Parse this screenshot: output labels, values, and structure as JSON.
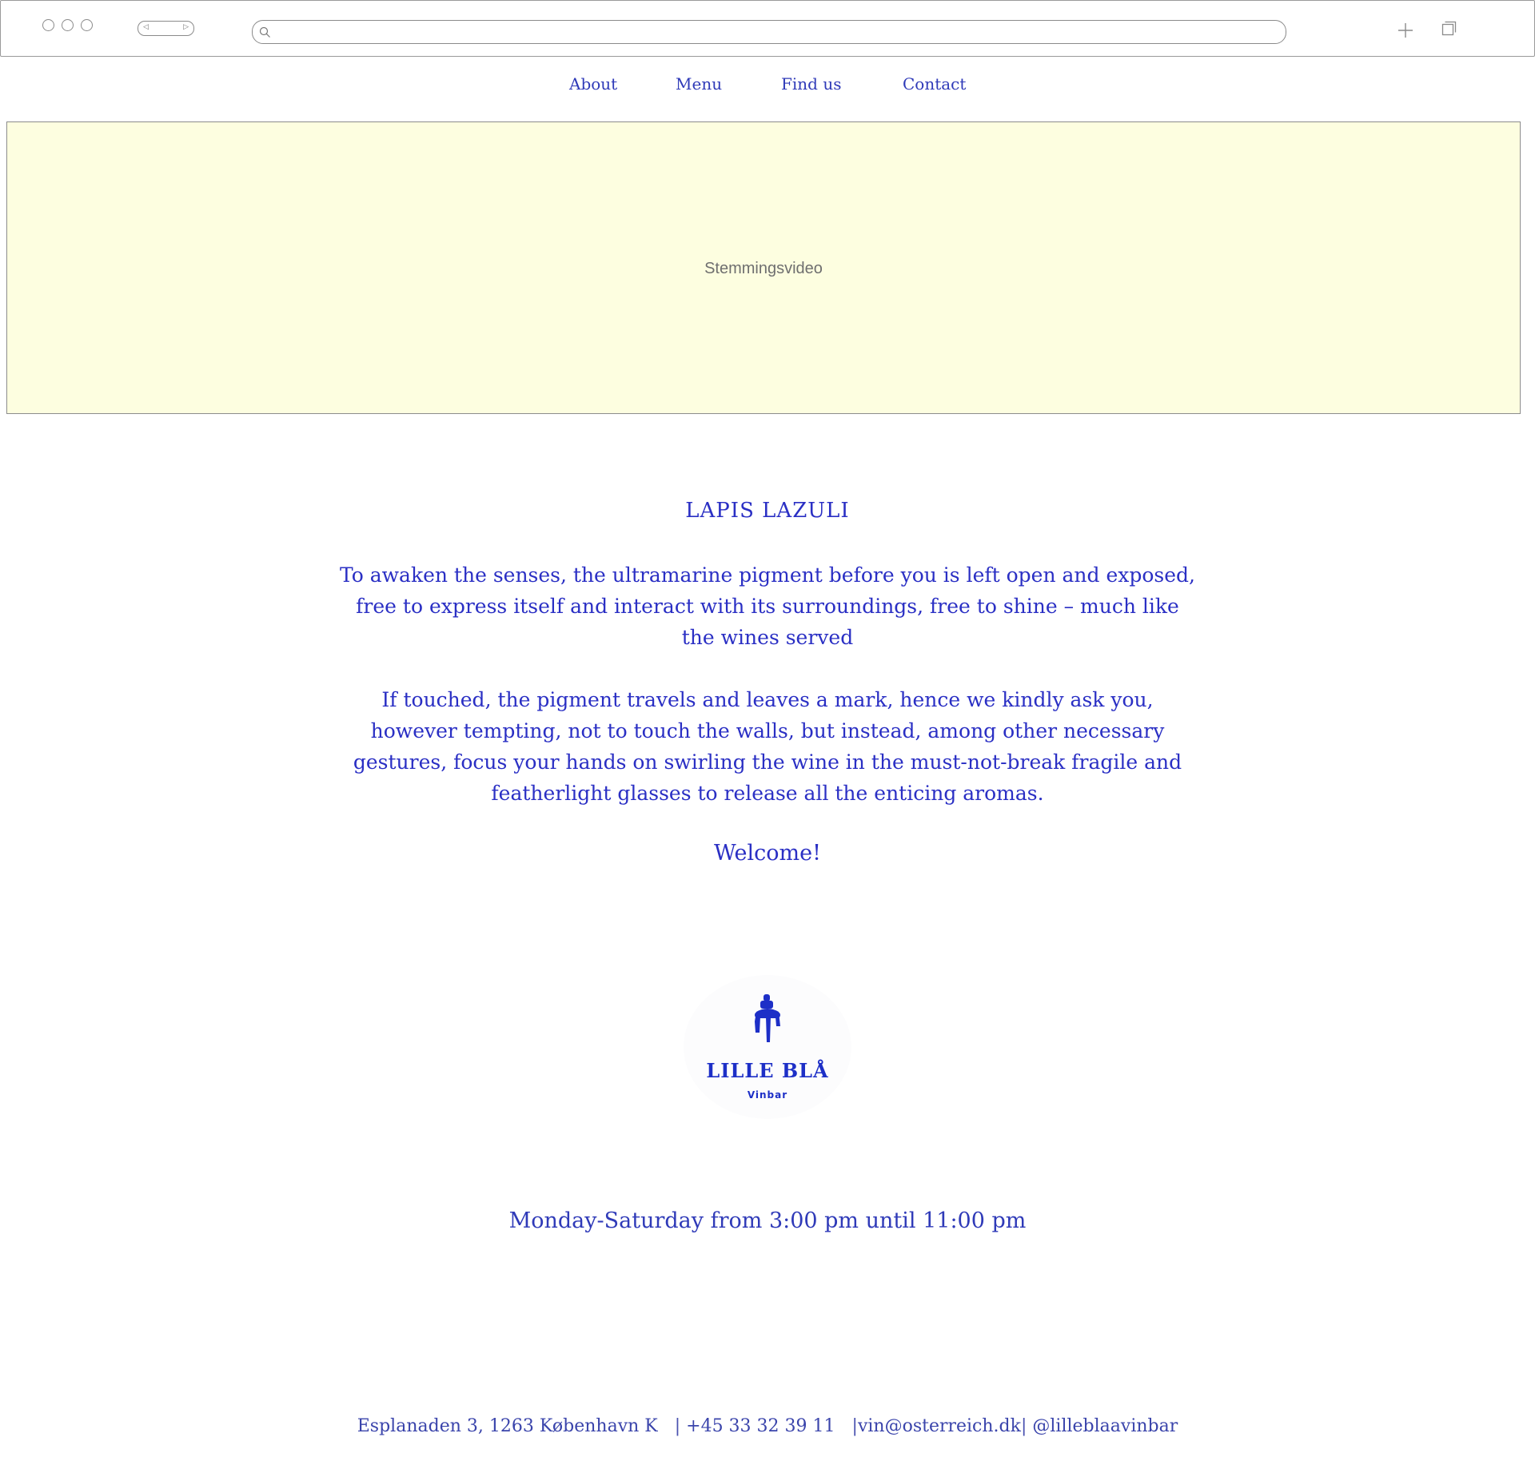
{
  "nav": {
    "items": [
      {
        "label": "About"
      },
      {
        "label": "Menu"
      },
      {
        "label": "Find us"
      },
      {
        "label": "Contact"
      }
    ]
  },
  "hero": {
    "placeholder_label": "Stemmingsvideo"
  },
  "intro": {
    "title": "LAPIS LAZULI",
    "paragraph1": "To awaken the senses, the ultramarine pigment before you is left open and exposed, free to express itself and interact with its surroundings, free to shine – much like the wines served",
    "paragraph2": "If touched, the pigment travels and leaves a mark, hence we kindly ask you, however tempting, not to touch the walls, but instead, among other necessary gestures, focus your hands on swirling the wine in the must-not-break fragile and featherlight glasses to release all the enticing aromas.",
    "welcome": "Welcome!"
  },
  "logo": {
    "name": "LILLE BLÅ",
    "subtitle": "Vinbar"
  },
  "hours": "Monday-Saturday from 3:00 pm until 11:00 pm",
  "footer": {
    "address": "Esplanaden 3, 1263 København K",
    "phone": "+45 33 32 39 11",
    "email": "vin@osterreich.dk",
    "instagram": "@lilleblaavinbar"
  },
  "colors": {
    "text_blue": "#2a2fc4",
    "logo_blue": "#1d2fc7",
    "video_background": "#fdfee0"
  }
}
